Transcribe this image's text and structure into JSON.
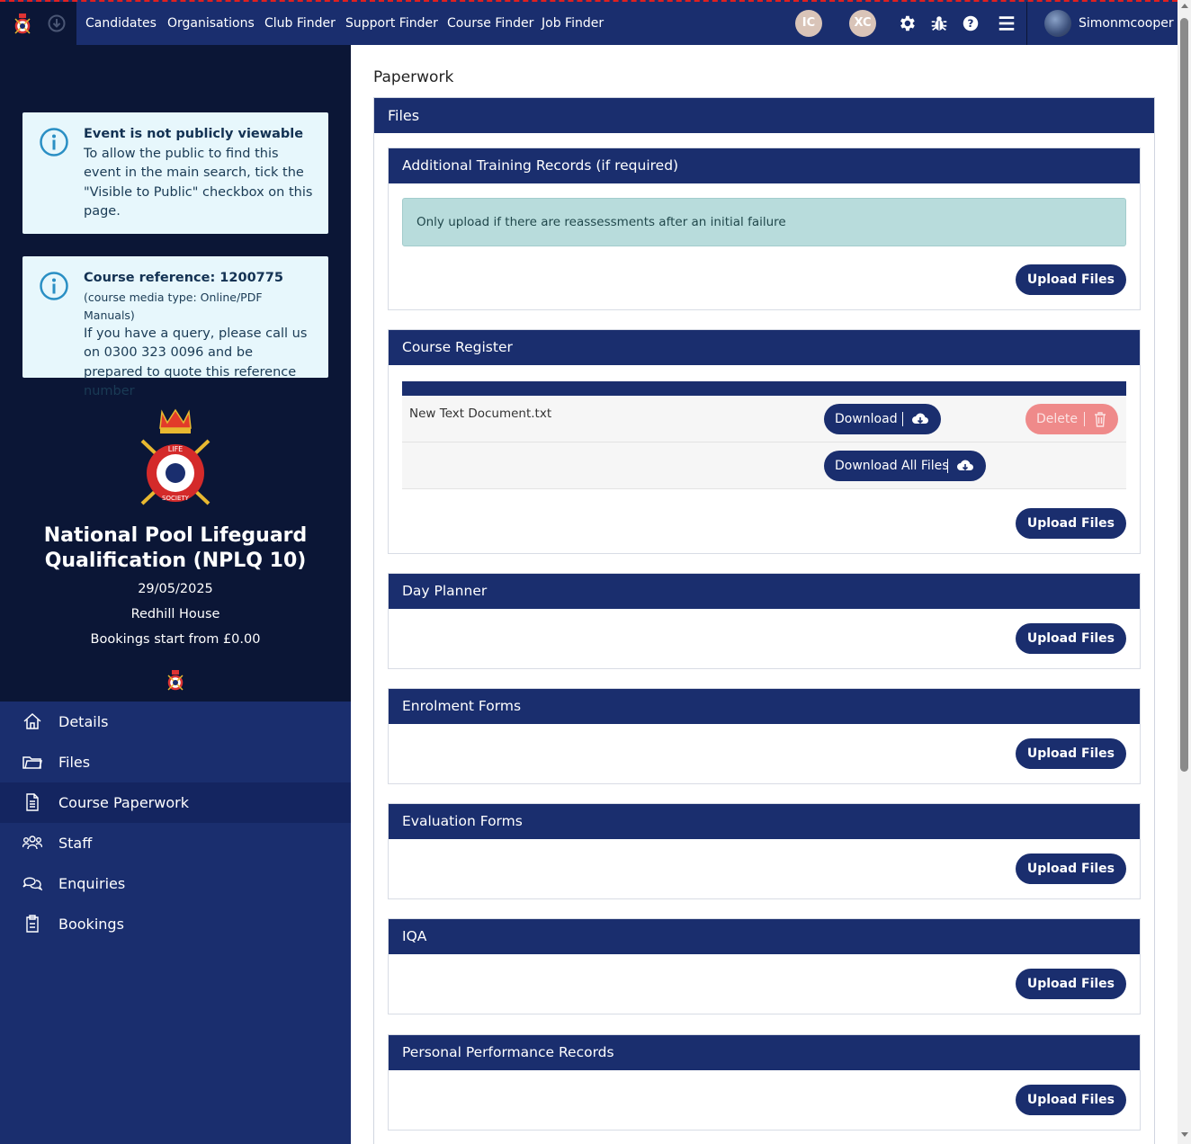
{
  "topbar": {
    "nav": [
      "Candidates",
      "Organisations",
      "Club Finder",
      "Support Finder",
      "Course Finder",
      "Job Finder"
    ],
    "badges": [
      "IC",
      "XC"
    ],
    "user": "Simonmcooper",
    "icons": [
      "rls-crest-icon",
      "download-circle-icon",
      "gear-icon",
      "bug-icon",
      "help-icon",
      "menu-icon"
    ]
  },
  "sidebar": {
    "notice": {
      "title": "Event is not publicly viewable",
      "body": "To allow the public to find this event in the main search, tick the \"Visible to Public\" checkbox on this page."
    },
    "reference": {
      "title": "Course reference: 1200775",
      "media": "(course media type: Online/PDF Manuals)",
      "body": "If you have a query, please call us on 0300 323 0096 and be prepared to quote this reference number"
    },
    "course": {
      "title": "National Pool Lifeguard Qualification (NPLQ 10)",
      "date": "29/05/2025",
      "venue": "Redhill House",
      "price": "Bookings start from £0.00"
    },
    "menu": [
      {
        "label": "Details",
        "icon": "home-icon"
      },
      {
        "label": "Files",
        "icon": "folder-icon"
      },
      {
        "label": "Course Paperwork",
        "icon": "document-icon",
        "active": true
      },
      {
        "label": "Staff",
        "icon": "people-icon"
      },
      {
        "label": "Enquiries",
        "icon": "chat-icon"
      },
      {
        "label": "Bookings",
        "icon": "clipboard-icon"
      }
    ]
  },
  "main": {
    "title": "Paperwork",
    "panel_title": "Files",
    "upload_label": "Upload Files",
    "sections": [
      {
        "title": "Additional Training Records (if required)",
        "note": "Only upload if there are reassessments after an initial failure"
      },
      {
        "title": "Course Register"
      },
      {
        "title": "Day Planner"
      },
      {
        "title": "Enrolment Forms"
      },
      {
        "title": "Evaluation Forms"
      },
      {
        "title": "IQA"
      },
      {
        "title": "Personal Performance Records"
      }
    ],
    "register": {
      "file_name": "New Text Document.txt",
      "download_label": "Download",
      "delete_label": "Delete",
      "download_all_label": "Download All Files"
    }
  }
}
